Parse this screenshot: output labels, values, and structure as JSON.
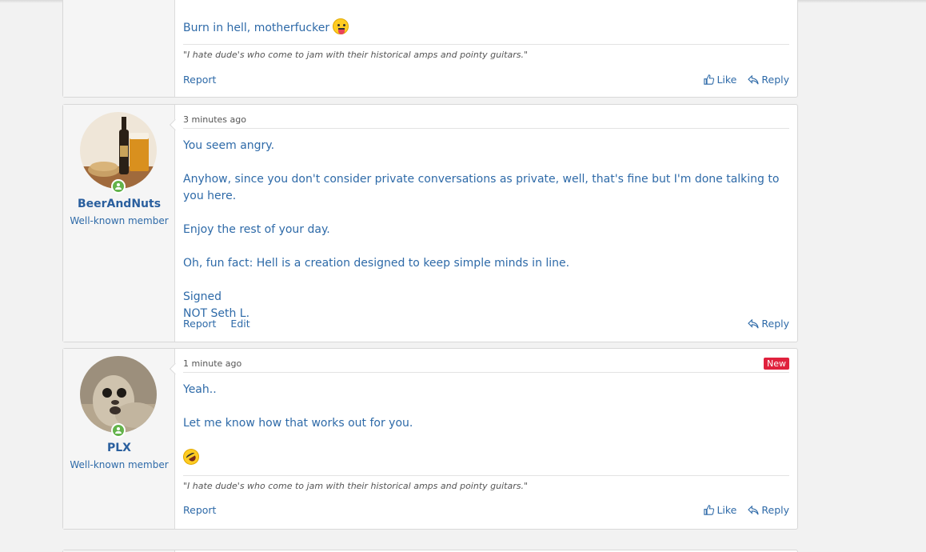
{
  "posts": [
    {
      "body": {
        "line": "Burn in hell, motherfucker",
        "emoji": "stuck-out-tongue-emoji"
      },
      "signature": "\"I hate dude's who come to jam with their historical amps and pointy guitars.\"",
      "actions": {
        "report": "Report",
        "like": "Like",
        "reply": "Reply"
      }
    },
    {
      "user": {
        "name": "BeerAndNuts",
        "title": "Well-known member",
        "online": true
      },
      "time": "3 minutes ago",
      "paragraphs": [
        "You seem angry.",
        "Anyhow, since you don't consider private conversations as private, well, that's fine but I'm done talking to you here.",
        "Enjoy the rest of your day.",
        "Oh, fun fact: Hell is a creation designed to keep simple minds in line."
      ],
      "signed": [
        "Signed",
        "NOT Seth L."
      ],
      "actions": {
        "report": "Report",
        "edit": "Edit",
        "reply": "Reply"
      }
    },
    {
      "user": {
        "name": "PLX",
        "title": "Well-known member",
        "online": true
      },
      "time": "1 minute ago",
      "badge": "New",
      "paragraphs": [
        "Yeah..",
        "Let me know how that works out for you."
      ],
      "emoji": "rofl-emoji",
      "signature": "\"I hate dude's who come to jam with their historical amps and pointy guitars.\"",
      "actions": {
        "report": "Report",
        "like": "Like",
        "reply": "Reply"
      }
    }
  ],
  "colors": {
    "link": "#2e6aa8",
    "username": "#2a5f9e",
    "new_badge": "#e0213d",
    "online": "#63b34a",
    "background": "#f2f2f2"
  }
}
